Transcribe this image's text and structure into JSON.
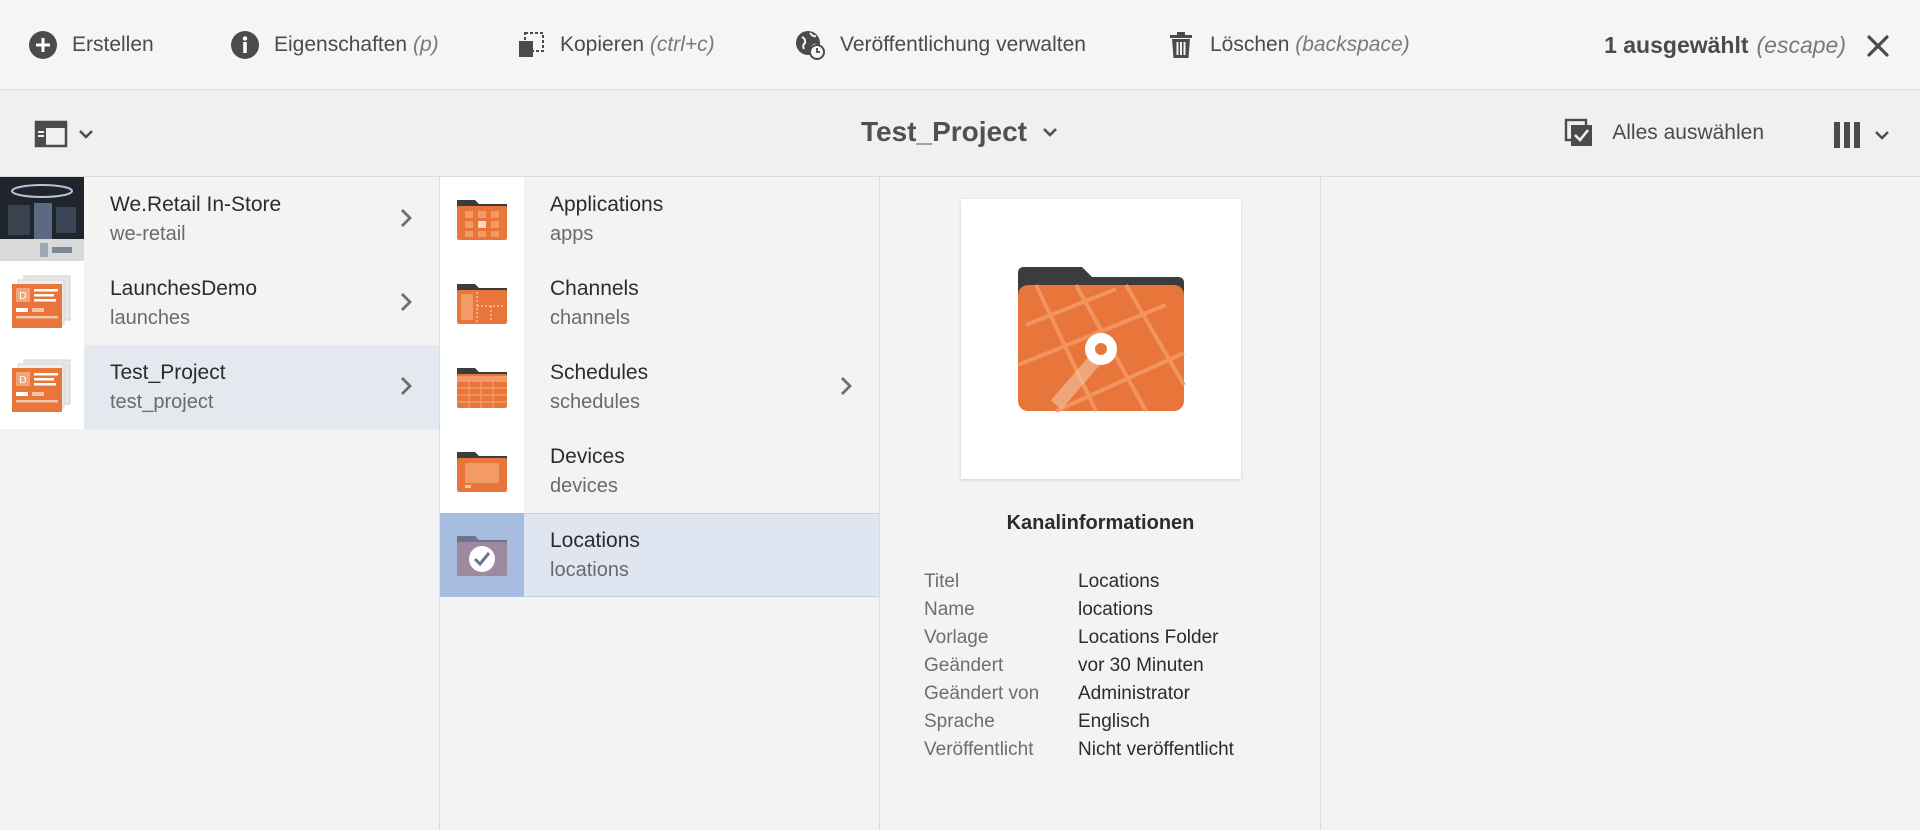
{
  "actionbar": {
    "create": {
      "label": "Erstellen",
      "shortcut": ""
    },
    "properties": {
      "label": "Eigenschaften",
      "shortcut": "(p)"
    },
    "copy": {
      "label": "Kopieren",
      "shortcut": "(ctrl+c)"
    },
    "publish": {
      "label": "Veröffentlichung verwalten",
      "shortcut": ""
    },
    "delete": {
      "label": "Löschen",
      "shortcut": "(backspace)"
    },
    "selection_count": "1 ausgewählt",
    "selection_shortcut": "(escape)"
  },
  "titlebar": {
    "title": "Test_Project",
    "select_all": "Alles auswählen"
  },
  "column1": [
    {
      "title": "We.Retail In-Store",
      "subtitle": "we-retail",
      "thumb": "photo-thumbnail"
    },
    {
      "title": "LaunchesDemo",
      "subtitle": "launches",
      "thumb": "project-thumbnail"
    },
    {
      "title": "Test_Project",
      "subtitle": "test_project",
      "thumb": "project-thumbnail"
    }
  ],
  "column2": [
    {
      "title": "Applications",
      "subtitle": "apps",
      "icon": "applications-folder-icon"
    },
    {
      "title": "Channels",
      "subtitle": "channels",
      "icon": "channels-folder-icon"
    },
    {
      "title": "Schedules",
      "subtitle": "schedules",
      "icon": "schedules-folder-icon"
    },
    {
      "title": "Devices",
      "subtitle": "devices",
      "icon": "devices-folder-icon"
    },
    {
      "title": "Locations",
      "subtitle": "locations",
      "icon": "check-icon"
    }
  ],
  "preview": {
    "heading": "Kanalinformationen",
    "icon": "locations-folder-icon",
    "meta": [
      {
        "key": "Titel",
        "value": "Locations"
      },
      {
        "key": "Name",
        "value": "locations"
      },
      {
        "key": "Vorlage",
        "value": "Locations Folder"
      },
      {
        "key": "Geändert",
        "value": "vor 30 Minuten"
      },
      {
        "key": "Geändert von",
        "value": "Administrator"
      },
      {
        "key": "Sprache",
        "value": "Englisch"
      },
      {
        "key": "Veröffentlicht",
        "value": "Nicht veröffentlicht"
      }
    ]
  },
  "colors": {
    "accent_orange": "#e8763a",
    "folder_dark": "#3c3c3c",
    "selected_row": "#dfe6f2",
    "selected_thumb": "#a7bde0"
  }
}
